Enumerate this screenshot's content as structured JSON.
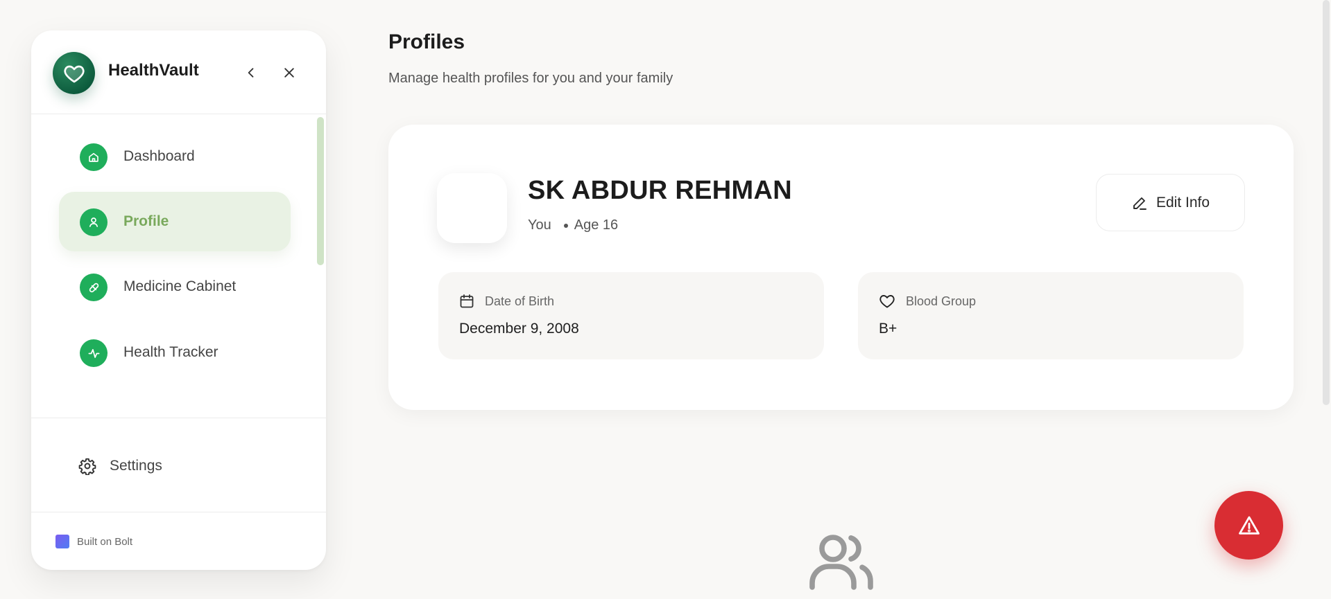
{
  "app": {
    "title": "HealthVault"
  },
  "sidebar": {
    "items": [
      {
        "label": "Dashboard",
        "icon": "home-icon",
        "active": false
      },
      {
        "label": "Profile",
        "icon": "user-icon",
        "active": true
      },
      {
        "label": "Medicine Cabinet",
        "icon": "pill-icon",
        "active": false
      },
      {
        "label": "Health Tracker",
        "icon": "activity-icon",
        "active": false
      }
    ],
    "settings_label": "Settings",
    "footer_label": "Built on Bolt"
  },
  "page": {
    "title": "Profiles",
    "subtitle": "Manage health profiles for you and your family"
  },
  "profile": {
    "name": "SK ABDUR REHMAN",
    "relation": "You",
    "age": "Age 16",
    "edit_label": "Edit Info",
    "dob_label": "Date of Birth",
    "dob_value": "December 9, 2008",
    "blood_label": "Blood Group",
    "blood_value": "B+"
  },
  "colors": {
    "accent_green": "#1fae5b",
    "active_bg": "#e9f2e4",
    "active_text": "#79a95c",
    "logo_green": "#0c5a3c",
    "sos_red": "#d92d33"
  }
}
